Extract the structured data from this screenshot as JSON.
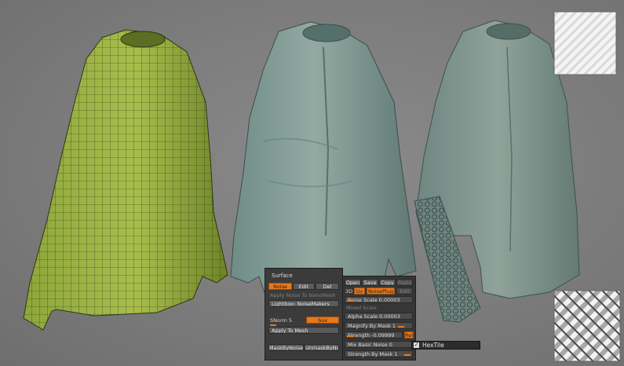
{
  "surface_panel": {
    "title": "Surface",
    "buttons": {
      "noise": "Noise",
      "edit": "Edit",
      "del": "Del",
      "apply_noise_nanomesh": "Apply Noise To NanoMesh",
      "lightbox_noisemakers": "Lightbox› NoiseMakers",
      "suv": "Suv",
      "apply_to_mesh": "Apply To Mesh",
      "mask_by_noise": "MaskByNoise",
      "unmask_by_noise": "UnmaskByNo"
    },
    "snorm": "SNorm 5"
  },
  "noise_plug_panel": {
    "buttons": {
      "open": "Open",
      "save": "Save",
      "copy": "Copy",
      "paste": "Paste",
      "three_d": "3D",
      "uv": "Uv",
      "noiseplug": "NoisePlug",
      "edit": "Edit",
      "rel": "Rel"
    },
    "sliders": {
      "noise_scale": "Noise Scale 0.00003",
      "mixed_scale": "Mixed Scale",
      "alpha_scale": "Alpha Scale 0.00003",
      "magnify_by_mask": "Magnify By Mask 1",
      "strength": "Strength -0.09999",
      "mix_basic_noise": "Mix Basic Noise 0",
      "strength_by_mask": "Strength By Mask 1"
    }
  },
  "hextile": {
    "label": "HexTile",
    "checked": true,
    "check_glyph": "✓"
  },
  "colors": {
    "accent": "#e8781c",
    "background": "#7c7c7c",
    "panel": "#3b3b3b",
    "torso_wire": "#8fa83a",
    "torso_smooth": "#7f9a92",
    "torso_detail": "#80958c"
  }
}
